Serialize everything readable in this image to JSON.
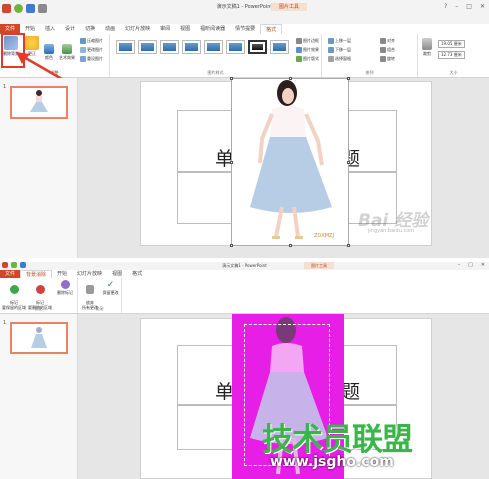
{
  "top": {
    "window_title": "演示文稿1 - PowerPoint",
    "context_tab": "图片工具",
    "tabs": [
      "文件",
      "开始",
      "插入",
      "设计",
      "切换",
      "动画",
      "幻灯片放映",
      "审阅",
      "视图",
      "福昕阅读器",
      "情节提要",
      "格式"
    ],
    "active_tab": "格式",
    "ribbon": {
      "remove_bg": "删除背景",
      "corrections": "更正",
      "color": "颜色",
      "artistic": "艺术效果",
      "compress": "压缩图片",
      "change": "更改图片",
      "reset": "重设图片",
      "adjust_group": "调整",
      "styles_group": "图片样式",
      "border": "图片边框",
      "effects": "图片效果",
      "layout": "图片版式",
      "forward": "上移一层",
      "backward": "下移一层",
      "selection": "选择窗格",
      "align": "对齐",
      "group": "组合",
      "rotate": "旋转",
      "arrange_group": "排列",
      "crop": "裁剪",
      "height": "19.05 厘米",
      "width": "12.73 厘米",
      "size_group": "大小"
    },
    "slide_number": "1",
    "title_left_char": "单",
    "title_right_char": "题",
    "photo_credit": "ZDXMZJ",
    "watermark_text": "Bai 经验",
    "watermark_sub": "jingyan.baidu.com"
  },
  "bottom": {
    "window_title": "演示文稿1 - PowerPoint",
    "context_tab": "图片工具",
    "tabs": [
      "文件",
      "背景消除",
      "开始",
      "幻灯片放映",
      "视图",
      "格式"
    ],
    "active_tab": "背景消除",
    "ribbon": {
      "mark_keep": "标记\n要保留的区域",
      "mark_remove": "标记\n要删除的区域",
      "delete_mark": "删除标记",
      "refine_group": "优化",
      "discard": "放弃\n所有更改",
      "keep_changes": "保留更改",
      "close_group": "关闭"
    },
    "slide_number": "1",
    "title_left_char": "单",
    "title_right_char": "题",
    "site_logo": "技术员联盟",
    "site_url": "www.jsgho.com"
  },
  "colors": {
    "file_tab": "#d24726",
    "accent_orange": "#b7472a",
    "magenta_bg": "#e61ee6",
    "annotation_red": "#e23b2a",
    "logo_green": "#39b54a",
    "skirt_blue": "#b7cde6"
  }
}
